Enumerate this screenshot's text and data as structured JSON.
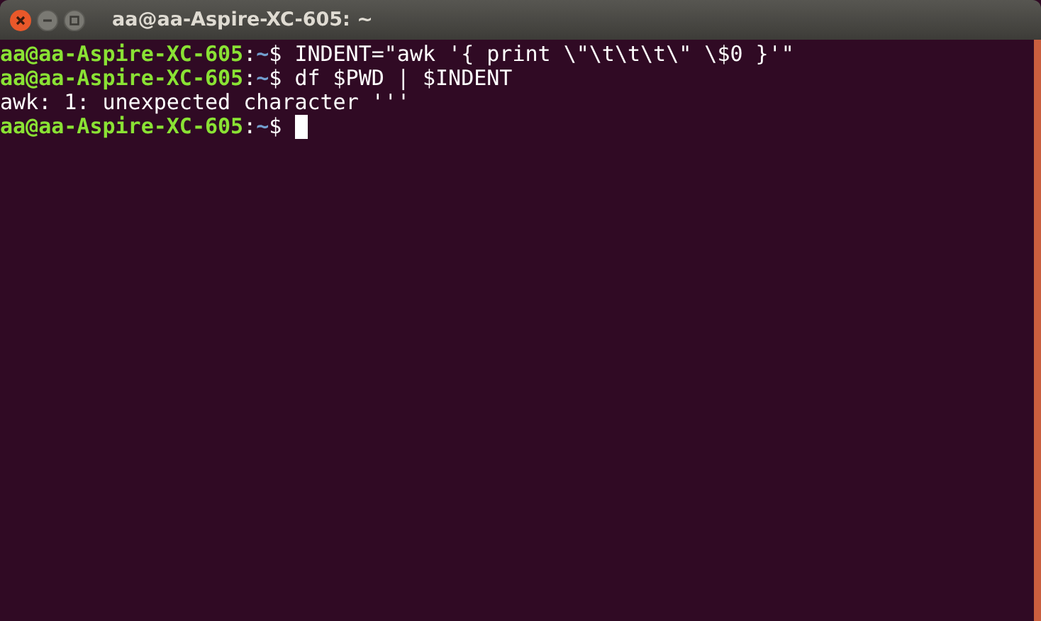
{
  "window": {
    "title": "aa@aa-Aspire-XC-605: ~"
  },
  "lines": [
    {
      "kind": "prompt",
      "user_host": "aa@aa-Aspire-XC-605",
      "separator": ":",
      "path": "~",
      "symbol": "$",
      "command": "INDENT=\"awk '{ print \\\"\\t\\t\\t\\\" \\$0 }'\"",
      "cursor": false
    },
    {
      "kind": "prompt",
      "user_host": "aa@aa-Aspire-XC-605",
      "separator": ":",
      "path": "~",
      "symbol": "$",
      "command": "df $PWD | $INDENT",
      "cursor": false
    },
    {
      "kind": "output",
      "text": "awk: 1: unexpected character '''"
    },
    {
      "kind": "prompt",
      "user_host": "aa@aa-Aspire-XC-605",
      "separator": ":",
      "path": "~",
      "symbol": "$",
      "cursor": true
    }
  ]
}
